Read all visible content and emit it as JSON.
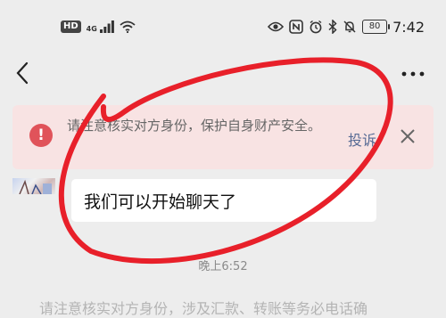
{
  "status_bar": {
    "hd_badge": "HD",
    "network_type": "4G",
    "time": "7:42",
    "battery_level": "80",
    "icons": [
      "eye-icon",
      "nfc-icon",
      "alarm-icon",
      "bluetooth-icon",
      "mute-bell-icon",
      "battery-icon"
    ]
  },
  "nav": {
    "back_icon": "chevron-left-icon",
    "more_icon": "more-dots-icon"
  },
  "warning": {
    "icon_text": "!",
    "message": "请注意核实对方身份，保护自身财产安全。",
    "complain_label": "投诉",
    "close_icon": "close-icon",
    "background_color": "#f8e3e3",
    "icon_color": "#e0535a"
  },
  "chat": {
    "message_text": "我们可以开始聊天了",
    "timestamp": "晚上6:52",
    "system_message_clipped": "请注意核实对方身份，涉及汇款、转账等务必电话确"
  },
  "annotation": {
    "color": "#e8202a",
    "shape": "freehand-circle"
  }
}
